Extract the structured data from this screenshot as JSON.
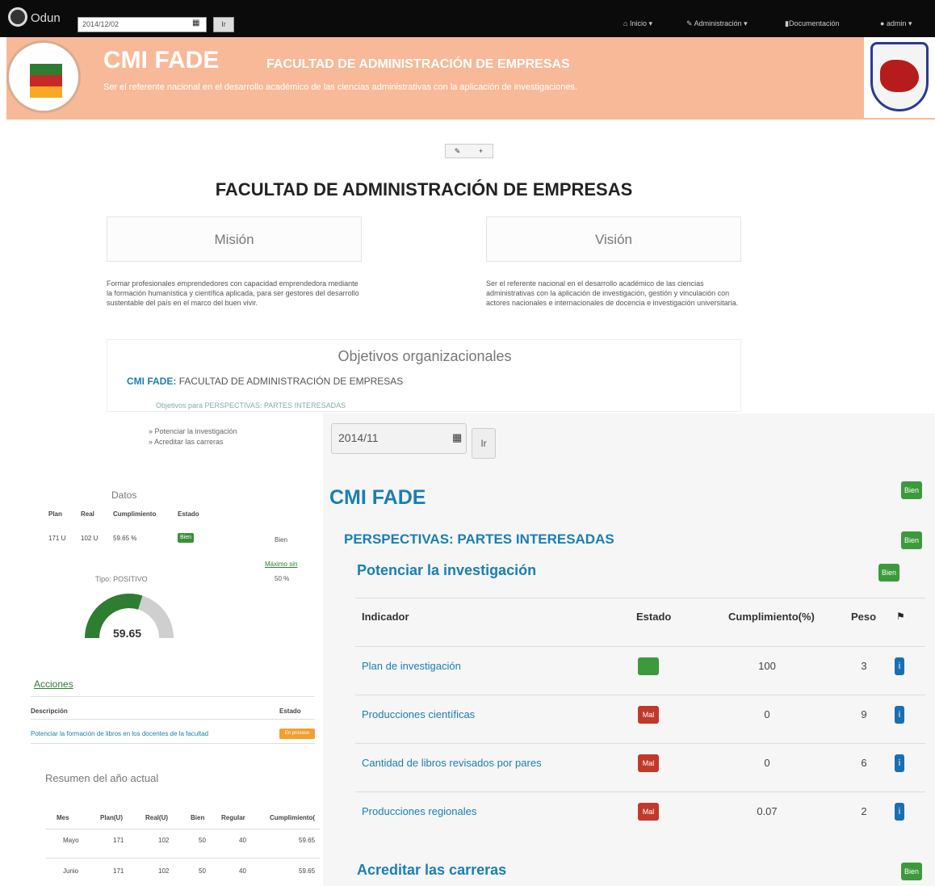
{
  "navbar": {
    "brand": "Odun",
    "date_value": "2014/12/02",
    "go_label": "Ir",
    "menu": [
      {
        "icon": "home-icon",
        "label": "Inicio ▾"
      },
      {
        "icon": "wrench-icon",
        "label": "Administración ▾"
      },
      {
        "icon": "book-icon",
        "label": "Documentación"
      },
      {
        "icon": "user-icon",
        "label": "admin ▾"
      }
    ]
  },
  "header": {
    "title": "CMI FADE",
    "subtitle": "FACULTAD DE ADMINISTRACIÓN DE EMPRESAS",
    "tagline": "Ser el referente nacional en el desarrollo académico de las ciencias administrativas con la aplicación de investigaciones."
  },
  "main": {
    "edit_label": "✎",
    "add_label": "+",
    "title": "FACULTAD DE ADMINISTRACIÓN DE EMPRESAS",
    "mision_title": "Misión",
    "vision_title": "Visión",
    "mision_text": "Formar profesionales emprendedores con capacidad emprendedora mediante la formación humanística y científica aplicada, para ser gestores del desarrollo sustentable del país en el marco del buen vivir.",
    "vision_text": "Ser el referente nacional en el desarrollo académico de las ciencias administrativas con la aplicación de investigación, gestión y vinculación con actores nacionales e internacionales de docencia e investigación universitaria.",
    "objetivos_title": "Objetivos organizacionales",
    "objetivos_cmi": "CMI FADE:",
    "objetivos_faculty": "FACULTAD DE ADMINISTRACIÓN DE EMPRESAS",
    "objetivos_sub": "Objetivos para PERSPECTIVAS: PARTES INTERESADAS",
    "objetivos_list": [
      "» Potenciar la investigación",
      "» Acreditar las carreras"
    ]
  },
  "left_panel": {
    "datos_title": "Datos",
    "headers": [
      "Plan",
      "Real",
      "Cumplimiento",
      "Estado"
    ],
    "row": [
      "171 U",
      "102 U",
      "59.65 %",
      "Bien"
    ],
    "side_labels": [
      "Bien",
      "Máximo sin",
      "50 %"
    ],
    "tipo": "Tipo: POSITIVO",
    "gauge_value": "59.65",
    "gauge_fraction": 0.5965,
    "acciones_title": "Acciones",
    "acciones_headers": [
      "Descripción",
      "Estado"
    ],
    "accion_desc": "Potenciar la formación de libros en los docentes de la facultad",
    "accion_estado": "En proceso",
    "resumen_title": "Resumen del año actual",
    "resumen_headers": [
      "Mes",
      "Plan(U)",
      "Real(U)",
      "Bien",
      "Regular",
      "Cumplimiento("
    ],
    "resumen_rows": [
      [
        "Mayo",
        "171",
        "102",
        "50",
        "40",
        "59.65"
      ],
      [
        "Junio",
        "171",
        "102",
        "50",
        "40",
        "59.65"
      ]
    ]
  },
  "right_panel": {
    "date_value": "2014/11",
    "go_label": "Ir",
    "cmi_title": "CMI FADE",
    "cmi_badge": "Bien",
    "perspective": "PERSPECTIVAS: PARTES INTERESADAS",
    "perspective_badge": "Bien",
    "objective": "Potenciar la investigación",
    "objective_badge": "Bien",
    "headers": [
      "Indicador",
      "Estado",
      "Cumplimiento(%)",
      "Peso"
    ],
    "indicators": [
      {
        "name": "Plan de investigación",
        "estado": "",
        "estado_color": "#3c9a3c",
        "cumplimiento": "100",
        "peso": "3",
        "info": "i"
      },
      {
        "name": "Producciones científicas",
        "estado": "Mal",
        "estado_color": "#c0392b",
        "cumplimiento": "0",
        "peso": "9",
        "info": "i"
      },
      {
        "name": "Cantidad de libros revisados por pares",
        "estado": "Mal",
        "estado_color": "#c0392b",
        "cumplimiento": "0",
        "peso": "6",
        "info": "i"
      },
      {
        "name": "Producciones regionales",
        "estado": "Mal",
        "estado_color": "#c0392b",
        "cumplimiento": "0.07",
        "peso": "2",
        "info": "i"
      }
    ],
    "objective2": "Acreditar las carreras",
    "objective2_badge": "Bien"
  },
  "colors": {
    "accent": "#1a7fb2",
    "header_bg": "#f7b998",
    "good": "#3c9a3c",
    "bad": "#c0392b"
  }
}
